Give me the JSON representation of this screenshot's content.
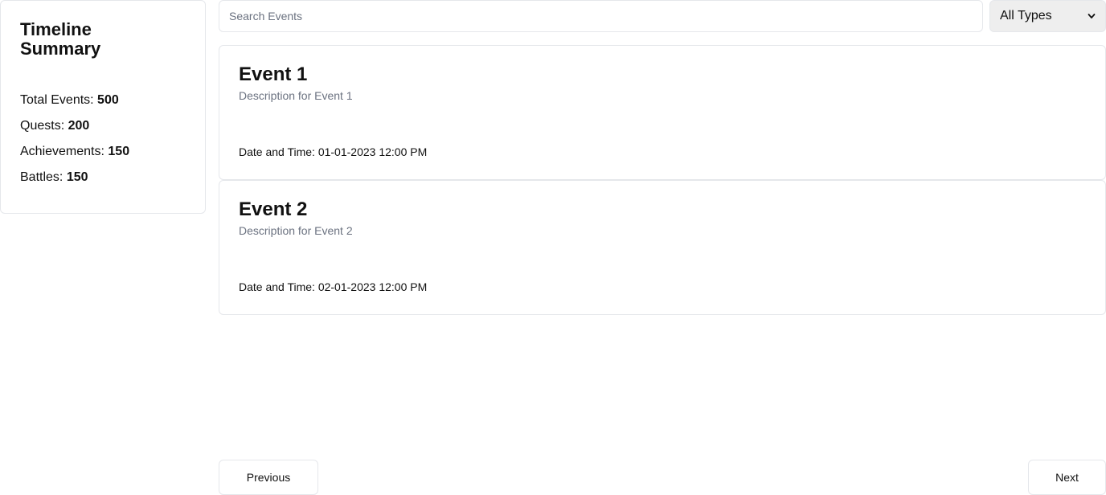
{
  "sidebar": {
    "title": "Timeline Summary",
    "stats": [
      {
        "label": "Total Events: ",
        "value": "500"
      },
      {
        "label": "Quests: ",
        "value": "200"
      },
      {
        "label": "Achievements: ",
        "value": "150"
      },
      {
        "label": "Battles: ",
        "value": "150"
      }
    ]
  },
  "search": {
    "placeholder": "Search Events",
    "value": ""
  },
  "filter": {
    "selected": "All Types"
  },
  "events": [
    {
      "title": "Event 1",
      "description": "Description for Event 1",
      "datetime": "Date and Time: 01-01-2023 12:00 PM"
    },
    {
      "title": "Event 2",
      "description": "Description for Event 2",
      "datetime": "Date and Time: 02-01-2023 12:00 PM"
    }
  ],
  "pagination": {
    "prev_label": "Previous",
    "next_label": "Next"
  },
  "icons": {
    "filter_chevron": "chevron-down-icon"
  }
}
